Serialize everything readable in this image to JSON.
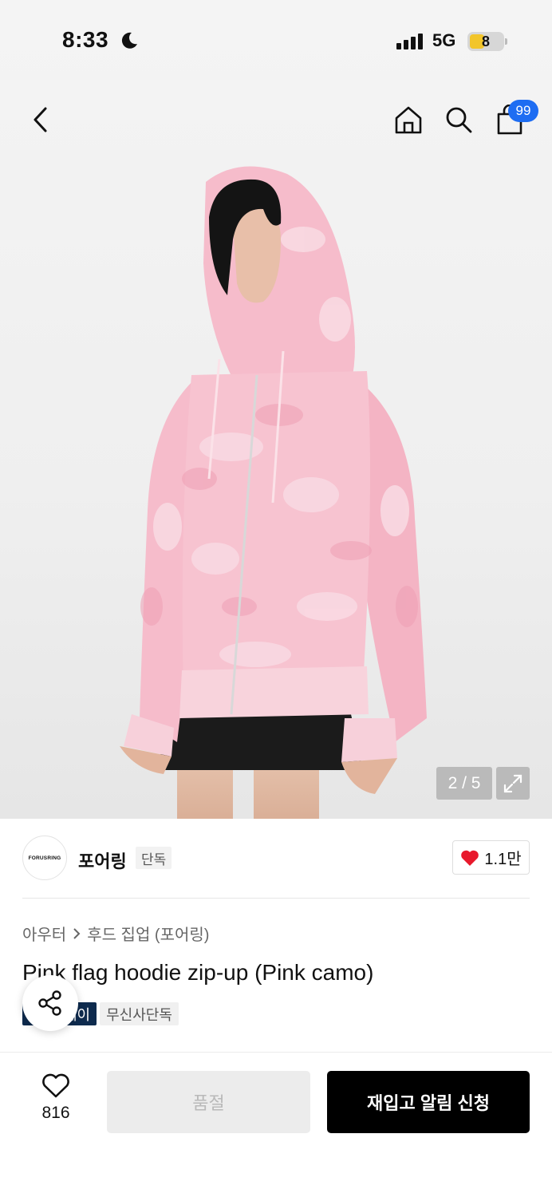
{
  "status_bar": {
    "time": "8:33",
    "network": "5G",
    "battery": "8"
  },
  "nav": {
    "back_icon": "chevron-left-icon",
    "home_icon": "home-icon",
    "search_icon": "search-icon",
    "cart_icon": "shopping-bag-icon",
    "cart_count": "99"
  },
  "gallery": {
    "counter": "2 / 5",
    "expand_icon": "expand-icon"
  },
  "brand": {
    "logo_text": "FORUSRING",
    "name": "포어링",
    "tag": "단독",
    "like_count": "1.1만"
  },
  "breadcrumb": {
    "category": "아우터",
    "separator": ">",
    "subcategory": "후드 집업 (포어링)"
  },
  "product": {
    "title": "Pink flag hoodie zip-up (Pink camo)",
    "badges": [
      {
        "label": "페이"
      },
      {
        "label": "무신사단독"
      }
    ]
  },
  "bottom_bar": {
    "wish_count": "816",
    "soldout_label": "품절",
    "restock_label": "재입고 알림 신청"
  },
  "colors": {
    "accent_blue": "#1e6df2",
    "like_red": "#e8192c",
    "badge_navy": "#0e2b4e",
    "hoodie_pink": "#f4b7c8"
  }
}
